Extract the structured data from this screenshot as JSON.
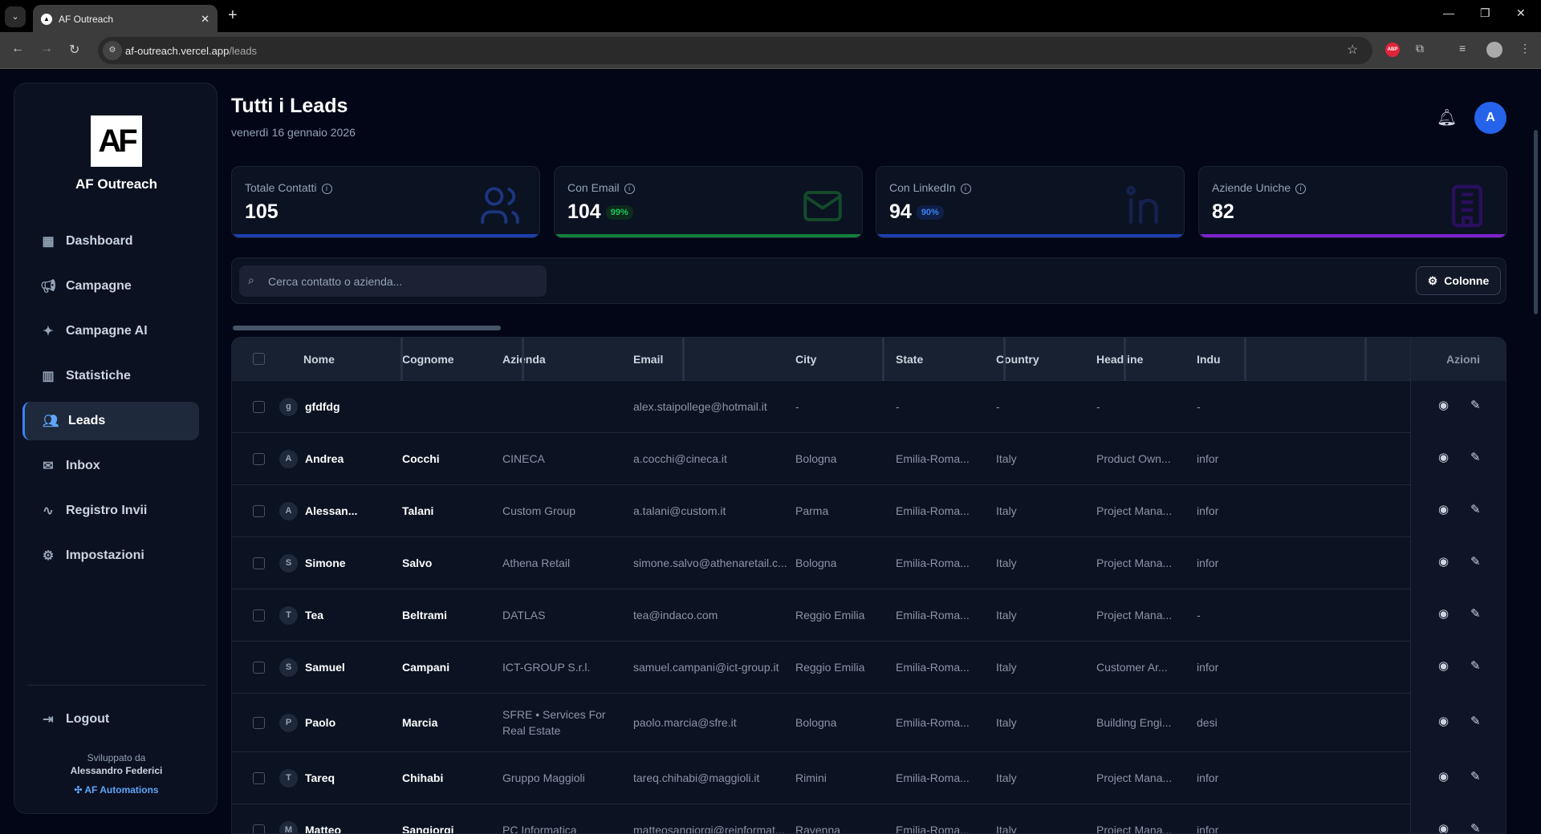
{
  "browser": {
    "tab_title": "AF Outreach",
    "url_host": "af-outreach.vercel.app",
    "url_path": "/leads",
    "abp_label": "ABP"
  },
  "sidebar": {
    "brand": "AF Outreach",
    "logo_text": "AF",
    "items": [
      {
        "label": "Dashboard",
        "icon": "dashboard-icon"
      },
      {
        "label": "Campagne",
        "icon": "megaphone-icon"
      },
      {
        "label": "Campagne AI",
        "icon": "sparkles-icon"
      },
      {
        "label": "Statistiche",
        "icon": "bar-chart-icon"
      },
      {
        "label": "Leads",
        "icon": "users-icon",
        "active": true
      },
      {
        "label": "Inbox",
        "icon": "inbox-icon"
      },
      {
        "label": "Registro Invii",
        "icon": "activity-icon"
      },
      {
        "label": "Impostazioni",
        "icon": "gear-icon"
      }
    ],
    "logout": "Logout",
    "credit_label": "Sviluppato da",
    "credit_name": "Alessandro Federici",
    "credit_link": "AF Automations"
  },
  "header": {
    "title": "Tutti i Leads",
    "date": "venerdì 16 gennaio 2026",
    "avatar": "A"
  },
  "stats": [
    {
      "label": "Totale Contatti",
      "value": "105",
      "pct": null,
      "color": "#1e40af"
    },
    {
      "label": "Con Email",
      "value": "104",
      "pct": "99%",
      "color": "#15803d"
    },
    {
      "label": "Con LinkedIn",
      "value": "94",
      "pct": "90%",
      "color": "#1e40af"
    },
    {
      "label": "Aziende Uniche",
      "value": "82",
      "pct": null,
      "color": "#7e22ce"
    }
  ],
  "search": {
    "placeholder": "Cerca contatto o azienda...",
    "value": ""
  },
  "columns_button": "Colonne",
  "table": {
    "headers": [
      "Nome",
      "Cognome",
      "Azienda",
      "Email",
      "City",
      "State",
      "Country",
      "Headline",
      "Indu",
      "Azioni"
    ],
    "rows": [
      {
        "ini": "g",
        "nome": "gfdfdg",
        "cognome": "",
        "azienda": "",
        "email": "alex.staipollege@hotmail.it",
        "city": "-",
        "state": "-",
        "country": "-",
        "headline": "-",
        "industry": "-"
      },
      {
        "ini": "A",
        "nome": "Andrea",
        "cognome": "Cocchi",
        "azienda": "CINECA",
        "email": "a.cocchi@cineca.it",
        "city": "Bologna",
        "state": "Emilia-Roma...",
        "country": "Italy",
        "headline": "Product Own...",
        "industry": "infor"
      },
      {
        "ini": "A",
        "nome": "Alessan...",
        "cognome": "Talani",
        "azienda": "Custom Group",
        "email": "a.talani@custom.it",
        "city": "Parma",
        "state": "Emilia-Roma...",
        "country": "Italy",
        "headline": "Project Mana...",
        "industry": "infor"
      },
      {
        "ini": "S",
        "nome": "Simone",
        "cognome": "Salvo",
        "azienda": "Athena Retail",
        "email": "simone.salvo@athenaretail.c...",
        "city": "Bologna",
        "state": "Emilia-Roma...",
        "country": "Italy",
        "headline": "Project Mana...",
        "industry": "infor"
      },
      {
        "ini": "T",
        "nome": "Tea",
        "cognome": "Beltrami",
        "azienda": "DATLAS",
        "email": "tea@indaco.com",
        "city": "Reggio Emilia",
        "state": "Emilia-Roma...",
        "country": "Italy",
        "headline": "Project Mana...",
        "industry": "-"
      },
      {
        "ini": "S",
        "nome": "Samuel",
        "cognome": "Campani",
        "azienda": "ICT-GROUP S.r.l.",
        "email": "samuel.campani@ict-group.it",
        "city": "Reggio Emilia",
        "state": "Emilia-Roma...",
        "country": "Italy",
        "headline": "Customer Ar...",
        "industry": "infor"
      },
      {
        "ini": "P",
        "nome": "Paolo",
        "cognome": "Marcia",
        "azienda": "SFRE • Services For Real Estate",
        "email": "paolo.marcia@sfre.it",
        "city": "Bologna",
        "state": "Emilia-Roma...",
        "country": "Italy",
        "headline": "Building Engi...",
        "industry": "desi"
      },
      {
        "ini": "T",
        "nome": "Tareq",
        "cognome": "Chihabi",
        "azienda": "Gruppo Maggioli",
        "email": "tareq.chihabi@maggioli.it",
        "city": "Rimini",
        "state": "Emilia-Roma...",
        "country": "Italy",
        "headline": "Project Mana...",
        "industry": "infor"
      },
      {
        "ini": "M",
        "nome": "Matteo",
        "cognome": "Sangiorgi",
        "azienda": "PC Informatica",
        "email": "matteosangiorgi@reinformat...",
        "city": "Ravenna",
        "state": "Emilia-Roma...",
        "country": "Italy",
        "headline": "Project Mana...",
        "industry": "infor"
      }
    ]
  }
}
